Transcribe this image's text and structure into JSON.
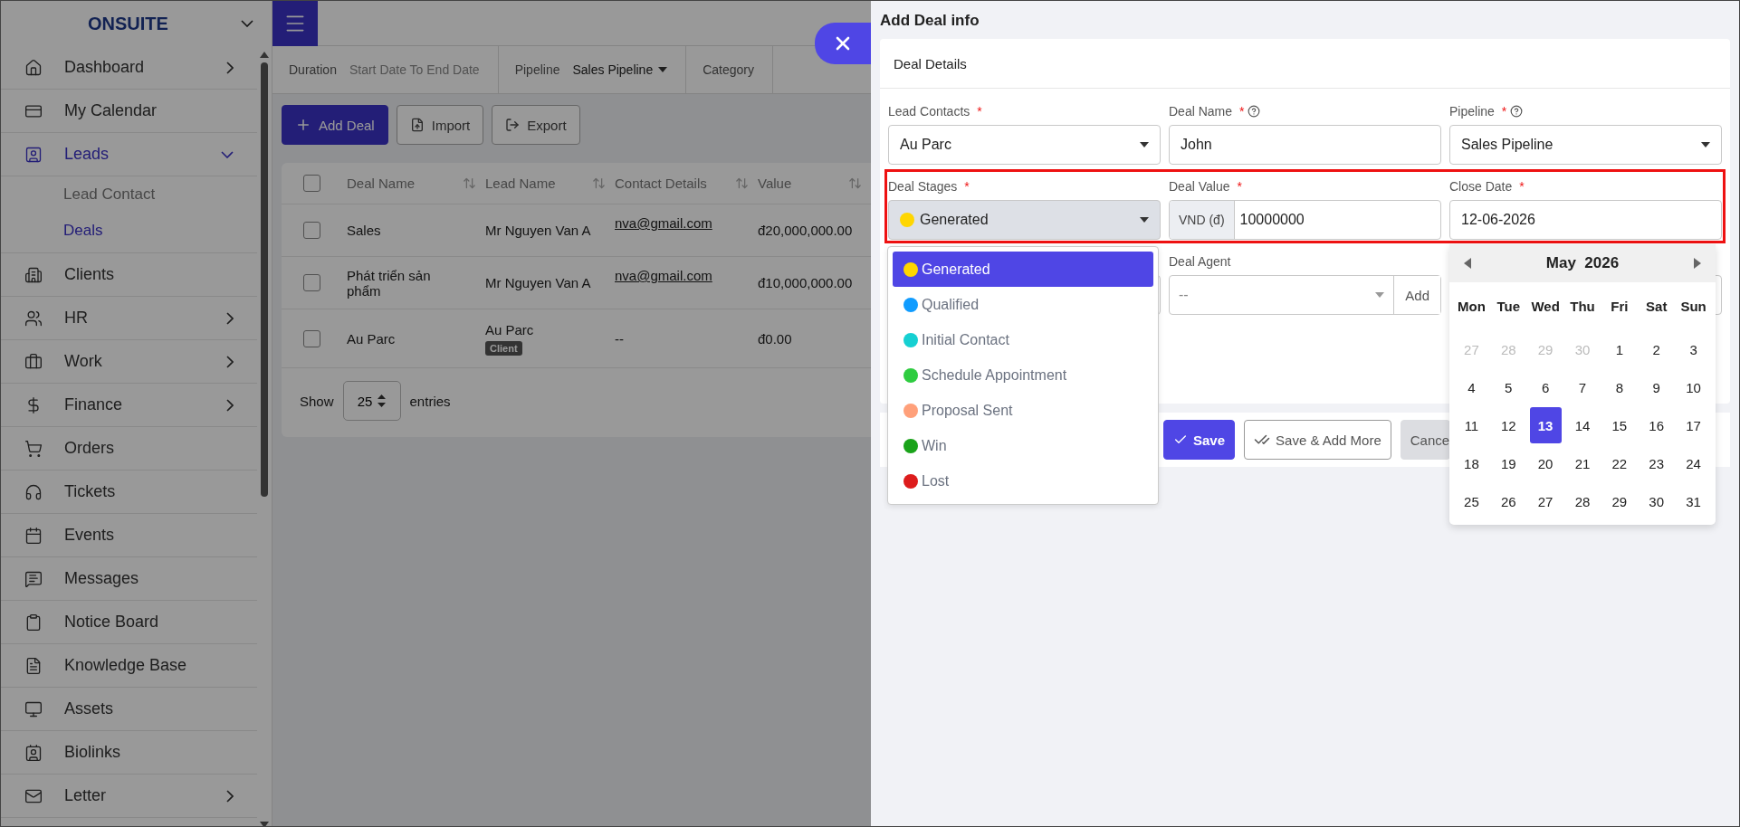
{
  "sidebar": {
    "brand": "ONSUITE",
    "items": [
      {
        "label": "Dashboard",
        "expanded": false,
        "selected": false
      },
      {
        "label": "My Calendar",
        "selected": false
      },
      {
        "label": "Leads",
        "expanded": true,
        "selected": true,
        "children": [
          {
            "label": "Lead Contact",
            "selected": false
          },
          {
            "label": "Deals",
            "selected": true
          }
        ]
      },
      {
        "label": "Clients",
        "selected": false
      },
      {
        "label": "HR",
        "expanded": false,
        "selected": false
      },
      {
        "label": "Work",
        "expanded": false,
        "selected": false
      },
      {
        "label": "Finance",
        "expanded": false,
        "selected": false
      },
      {
        "label": "Orders",
        "selected": false
      },
      {
        "label": "Tickets",
        "selected": false
      },
      {
        "label": "Events",
        "selected": false
      },
      {
        "label": "Messages",
        "selected": false
      },
      {
        "label": "Notice Board",
        "selected": false
      },
      {
        "label": "Knowledge Base",
        "selected": false
      },
      {
        "label": "Assets",
        "selected": false
      },
      {
        "label": "Biolinks",
        "selected": false
      },
      {
        "label": "Letter",
        "expanded": false,
        "selected": false
      }
    ]
  },
  "filters": [
    {
      "kind": "date",
      "label": "Duration",
      "value": "Start Date To End Date"
    },
    {
      "kind": "select",
      "label": "Pipeline",
      "value": "Sales Pipeline"
    },
    {
      "label": "Category"
    }
  ],
  "toolbar": [
    {
      "kind": "primary",
      "label": "Add Deal"
    },
    {
      "kind": "import",
      "label": "Import"
    },
    {
      "kind": "export",
      "label": "Export"
    }
  ],
  "table": {
    "header_checked": false,
    "columns": [
      "Deal Name",
      "Lead Name",
      "Contact Details",
      "Value"
    ],
    "rows": [
      {
        "checked": false,
        "deal_name": "Sales",
        "lead_name": "Mr Nguyen Van A",
        "contact": "nva@gmail.com",
        "linked": true,
        "value": "đ20,000,000.00"
      },
      {
        "checked": false,
        "deal_name": "Phát triển sản phẩm",
        "lead_name": "Mr Nguyen Van A",
        "contact": "nva@gmail.com",
        "linked": true,
        "value": "đ10,000,000.00"
      },
      {
        "checked": false,
        "deal_name": "Au Parc",
        "lead_name": "Au Parc",
        "lead_badge": "Client",
        "contact": "--",
        "linked": false,
        "value": "đ0.00"
      }
    ]
  },
  "pagination": {
    "show": "Show",
    "page_size": "25",
    "entries": "entries"
  },
  "panel": {
    "title": "Add Deal info",
    "section": "Deal Details",
    "rows": [
      {
        "highlighted": false,
        "fields": [
          {
            "kind": "select",
            "label": "Lead Contacts",
            "required_mark": "*",
            "value": "Au Parc"
          },
          {
            "kind": "input",
            "label": "Deal Name",
            "required_mark": "*",
            "help": true,
            "value": "John"
          },
          {
            "kind": "select",
            "label": "Pipeline",
            "required_mark": "*",
            "help": true,
            "value": "Sales Pipeline"
          }
        ]
      },
      {
        "highlighted": true,
        "fields": [
          {
            "kind": "stage",
            "label": "Deal Stages",
            "required_mark": "*",
            "value": "Generated",
            "color": "#ffd600"
          },
          {
            "kind": "currency",
            "label": "Deal Value",
            "required_mark": "*",
            "prefix": "VND (đ)",
            "value": "10000000"
          },
          {
            "kind": "input",
            "label": "Close Date",
            "required_mark": "*",
            "value": "12-06-2026"
          }
        ]
      },
      {
        "highlighted": false,
        "fields": [
          {
            "kind": "blank"
          },
          {
            "kind": "select-add",
            "label": "Deal Agent",
            "placeholder": "--",
            "button": "Add"
          },
          {
            "kind": "blank"
          }
        ]
      }
    ],
    "buttons": [
      {
        "kind": "primary",
        "label": "Save"
      },
      {
        "kind": "outline",
        "label": "Save & Add More"
      },
      {
        "kind": "secondary",
        "label": "Cance"
      }
    ]
  },
  "stage_options": [
    {
      "label": "Generated",
      "color": "#ffd600",
      "selected": true
    },
    {
      "label": "Qualified",
      "color": "#109cff",
      "selected": false
    },
    {
      "label": "Initial Contact",
      "color": "#16d0d2",
      "selected": false
    },
    {
      "label": "Schedule Appointment",
      "color": "#2ecc40",
      "selected": false
    },
    {
      "label": "Proposal Sent",
      "color": "#ffa07a",
      "selected": false
    },
    {
      "label": "Win",
      "color": "#1aa31a",
      "selected": false
    },
    {
      "label": "Lost",
      "color": "#dd1c1c",
      "selected": false
    }
  ],
  "calendar": {
    "month": "May",
    "year": "2026",
    "weekdays": [
      "Mon",
      "Tue",
      "Wed",
      "Thu",
      "Fri",
      "Sat",
      "Sun"
    ],
    "days": [
      {
        "label": "27",
        "outside": true,
        "selected": false
      },
      {
        "label": "28",
        "outside": true,
        "selected": false
      },
      {
        "label": "29",
        "outside": true,
        "selected": false
      },
      {
        "label": "30",
        "outside": true,
        "selected": false
      },
      {
        "label": "1",
        "outside": false,
        "selected": false
      },
      {
        "label": "2",
        "outside": false,
        "selected": false
      },
      {
        "label": "3",
        "outside": false,
        "selected": false
      },
      {
        "label": "4",
        "outside": false,
        "selected": false
      },
      {
        "label": "5",
        "outside": false,
        "selected": false
      },
      {
        "label": "6",
        "outside": false,
        "selected": false
      },
      {
        "label": "7",
        "outside": false,
        "selected": false
      },
      {
        "label": "8",
        "outside": false,
        "selected": false
      },
      {
        "label": "9",
        "outside": false,
        "selected": false
      },
      {
        "label": "10",
        "outside": false,
        "selected": false
      },
      {
        "label": "11",
        "outside": false,
        "selected": false
      },
      {
        "label": "12",
        "outside": false,
        "selected": false
      },
      {
        "label": "13",
        "outside": false,
        "selected": true
      },
      {
        "label": "14",
        "outside": false,
        "selected": false
      },
      {
        "label": "15",
        "outside": false,
        "selected": false
      },
      {
        "label": "16",
        "outside": false,
        "selected": false
      },
      {
        "label": "17",
        "outside": false,
        "selected": false
      },
      {
        "label": "18",
        "outside": false,
        "selected": false
      },
      {
        "label": "19",
        "outside": false,
        "selected": false
      },
      {
        "label": "20",
        "outside": false,
        "selected": false
      },
      {
        "label": "21",
        "outside": false,
        "selected": false
      },
      {
        "label": "22",
        "outside": false,
        "selected": false
      },
      {
        "label": "23",
        "outside": false,
        "selected": false
      },
      {
        "label": "24",
        "outside": false,
        "selected": false
      },
      {
        "label": "25",
        "outside": false,
        "selected": false
      },
      {
        "label": "26",
        "outside": false,
        "selected": false
      },
      {
        "label": "27",
        "outside": false,
        "selected": false
      },
      {
        "label": "28",
        "outside": false,
        "selected": false
      },
      {
        "label": "29",
        "outside": false,
        "selected": false
      },
      {
        "label": "30",
        "outside": false,
        "selected": false
      },
      {
        "label": "31",
        "outside": false,
        "selected": false
      }
    ]
  }
}
